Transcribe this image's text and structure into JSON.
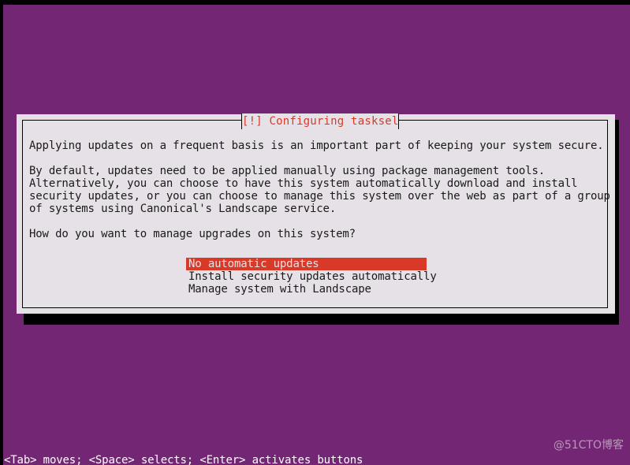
{
  "screen": {
    "background_color": "#722673",
    "border_color": "#000000"
  },
  "dialog": {
    "title": "[!] Configuring tasksel",
    "title_color": "#d83a28",
    "background_color": "#e6e1e6",
    "border_color": "#000000",
    "body_lines": [
      "Applying updates on a frequent basis is an important part of keeping your system secure.",
      "",
      "By default, updates need to be applied manually using package management tools.",
      "Alternatively, you can choose to have this system automatically download and install",
      "security updates, or you can choose to manage this system over the web as part of a group",
      "of systems using Canonical's Landscape service.",
      "",
      "How do you want to manage upgrades on this system?"
    ],
    "options": [
      {
        "label": "No automatic updates",
        "selected": true
      },
      {
        "label": "Install security updates automatically",
        "selected": false
      },
      {
        "label": "Manage system with Landscape",
        "selected": false
      }
    ],
    "selected_option_index": 0,
    "highlight_background_color": "#d93a28",
    "highlight_text_color": "#e6e1e6"
  },
  "status_bar": {
    "text": "<Tab> moves; <Space> selects; <Enter> activates buttons"
  },
  "watermark": {
    "text": "@51CTO博客"
  }
}
